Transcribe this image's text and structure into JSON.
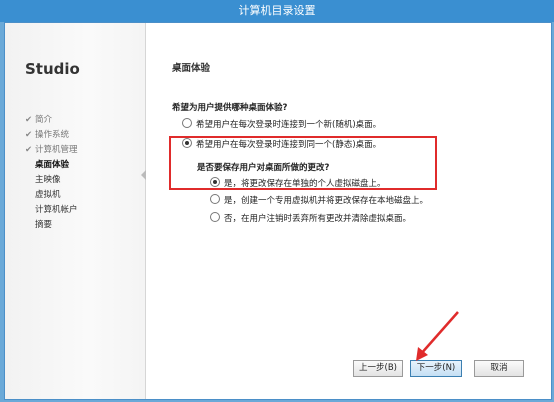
{
  "window": {
    "title": "计算机目录设置"
  },
  "sidebar": {
    "brand": "Studio",
    "items": [
      {
        "label": "简介",
        "state": "done"
      },
      {
        "label": "操作系统",
        "state": "done"
      },
      {
        "label": "计算机管理",
        "state": "done"
      },
      {
        "label": "桌面体验",
        "state": "active"
      },
      {
        "label": "主映像",
        "state": "todo"
      },
      {
        "label": "虚拟机",
        "state": "todo"
      },
      {
        "label": "计算机帐户",
        "state": "todo"
      },
      {
        "label": "摘要",
        "state": "todo"
      }
    ],
    "check_glyph": "✔"
  },
  "main": {
    "section_title": "桌面体验",
    "question": "希望为用户提供哪种桌面体验?",
    "options": [
      {
        "label": "希望用户在每次登录时连接到一个新(随机)桌面。",
        "selected": false
      },
      {
        "label": "希望用户在每次登录时连接到同一个(静态)桌面。",
        "selected": true
      }
    ],
    "sub_question": "是否要保存用户对桌面所做的更改?",
    "sub_options": [
      {
        "label": "是，将更改保存在单独的个人虚拟磁盘上。",
        "selected": true
      },
      {
        "label": "是，创建一个专用虚拟机并将更改保存在本地磁盘上。",
        "selected": false
      },
      {
        "label": "否，在用户注销时丢弃所有更改并清除虚拟桌面。",
        "selected": false
      }
    ]
  },
  "buttons": {
    "back": "上一步(B)",
    "next": "下一步(N)",
    "cancel": "取消"
  },
  "colors": {
    "titlebar": "#3a8fd1",
    "highlight": "#e02b2b"
  }
}
